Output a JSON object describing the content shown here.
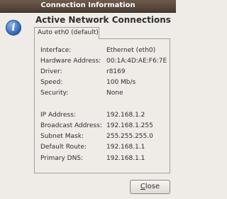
{
  "window": {
    "title": "Connection Information"
  },
  "dialog": {
    "heading": "Active Network Connections",
    "tab_label": "Auto eth0 (default)",
    "close_mnemonic": "C",
    "close_rest": "lose"
  },
  "fields": [
    {
      "label": "Interface:",
      "value": "Ethernet (eth0)"
    },
    {
      "label": "Hardware Address:",
      "value": "00:1A:4D:AE:F6:7E"
    },
    {
      "label": "Driver:",
      "value": "r8169"
    },
    {
      "label": "Speed:",
      "value": "100 Mb/s"
    },
    {
      "label": "Security:",
      "value": "None"
    },
    {
      "label": "IP Address:",
      "value": "192.168.1.2"
    },
    {
      "label": "Broadcast Address:",
      "value": "192.168.1.255"
    },
    {
      "label": "Subnet Mask:",
      "value": "255.255.255.0"
    },
    {
      "label": "Default Route:",
      "value": "192.168.1.1"
    },
    {
      "label": "Primary DNS:",
      "value": "192.168.1.1"
    }
  ]
}
